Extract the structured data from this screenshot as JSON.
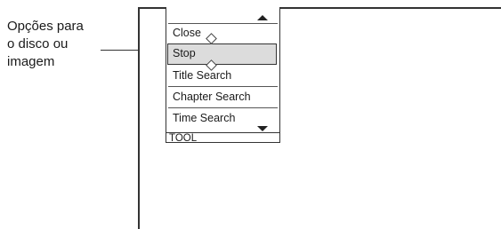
{
  "callout": {
    "lines": [
      "Opções para",
      "o disco ou",
      "imagem"
    ]
  },
  "menu": {
    "items": [
      {
        "label": "Close"
      },
      {
        "label": "Stop",
        "selected": true
      },
      {
        "label": "Title Search"
      },
      {
        "label": "Chapter Search"
      },
      {
        "label": "Time Search"
      }
    ],
    "footer_label": "TOOL"
  },
  "icons": {
    "scroll_up": "triangle-up",
    "scroll_down": "triangle-down",
    "cursor_markers": "diamond"
  }
}
